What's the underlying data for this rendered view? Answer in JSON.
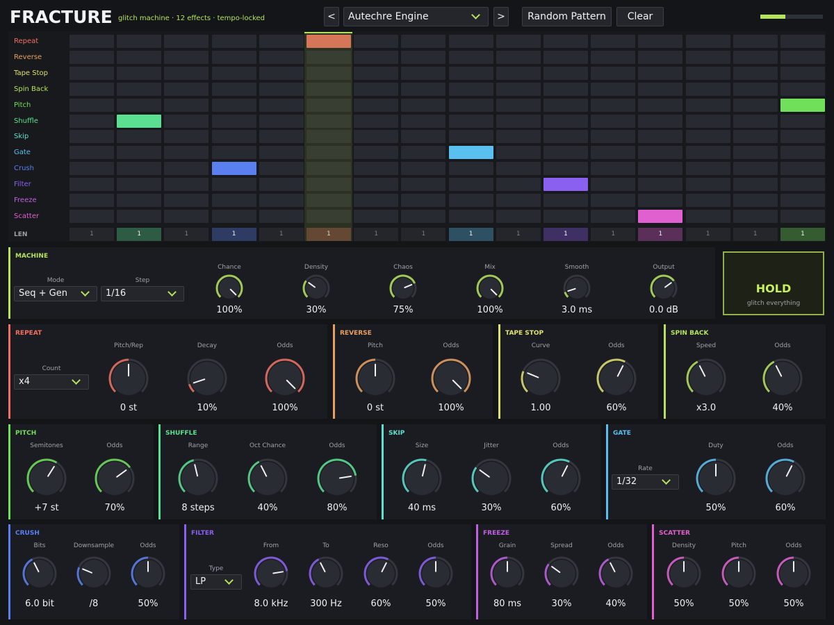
{
  "header": {
    "brand": "FRACTURE",
    "tagline": "glitch machine  ·  12 effects  ·  tempo-locked",
    "prev_label": "<",
    "next_label": ">",
    "preset": "Autechre Engine",
    "random_label": "Random Pattern",
    "clear_label": "Clear",
    "output_level": 0.4
  },
  "sequencer": {
    "steps": 16,
    "playhead_step": 6,
    "rows": [
      {
        "label": "Repeat",
        "color": "#f07060"
      },
      {
        "label": "Reverse",
        "color": "#e8a060"
      },
      {
        "label": "Tape Stop",
        "color": "#e0e070"
      },
      {
        "label": "Spin Back",
        "color": "#b5e35a"
      },
      {
        "label": "Pitch",
        "color": "#70e05a"
      },
      {
        "label": "Shuffle",
        "color": "#5ae090"
      },
      {
        "label": "Skip",
        "color": "#5ae0d0"
      },
      {
        "label": "Gate",
        "color": "#5ac0f0"
      },
      {
        "label": "Crush",
        "color": "#5a80f0"
      },
      {
        "label": "Filter",
        "color": "#8a60f0"
      },
      {
        "label": "Freeze",
        "color": "#c060e0"
      },
      {
        "label": "Scatter",
        "color": "#e060d0"
      }
    ],
    "active": [
      {
        "row": 0,
        "step": 5
      },
      {
        "row": 5,
        "step": 1
      },
      {
        "row": 8,
        "step": 3
      },
      {
        "row": 7,
        "step": 8
      },
      {
        "row": 9,
        "step": 10
      },
      {
        "row": 11,
        "step": 12
      },
      {
        "row": 4,
        "step": 15
      }
    ],
    "len_label": "LEN",
    "len_values": [
      "1",
      "1",
      "1",
      "1",
      "1",
      "1",
      "1",
      "1",
      "1",
      "1",
      "1",
      "1",
      "1",
      "1",
      "1",
      "1"
    ]
  },
  "machine": {
    "title": "MACHINE",
    "mode_label": "Mode",
    "mode_value": "Seq + Gen",
    "step_label": "Step",
    "step_value": "1/16",
    "knobs": [
      {
        "label": "Chance",
        "value": "100%",
        "level": 1.0
      },
      {
        "label": "Density",
        "value": "30%",
        "level": 0.3
      },
      {
        "label": "Chaos",
        "value": "75%",
        "level": 0.75
      },
      {
        "label": "Mix",
        "value": "100%",
        "level": 1.0
      },
      {
        "label": "Smooth",
        "value": "3.0 ms",
        "level": 0.1
      },
      {
        "label": "Output",
        "value": "0.0 dB",
        "level": 0.7
      }
    ]
  },
  "hold": {
    "title": "HOLD",
    "subtitle": "glitch everything"
  },
  "panels": {
    "repeat": {
      "title": "REPEAT",
      "color": "#f07060",
      "count_label": "Count",
      "count_value": "x4",
      "knobs": [
        {
          "label": "Pitch/Rep",
          "value": "0 st",
          "level": 0.5
        },
        {
          "label": "Decay",
          "value": "10%",
          "level": 0.1
        },
        {
          "label": "Odds",
          "value": "100%",
          "level": 1.0
        }
      ]
    },
    "reverse": {
      "title": "REVERSE",
      "color": "#e8a060",
      "knobs": [
        {
          "label": "Pitch",
          "value": "0 st",
          "level": 0.5
        },
        {
          "label": "Odds",
          "value": "100%",
          "level": 1.0
        }
      ]
    },
    "tapestop": {
      "title": "TAPE STOP",
      "color": "#e0e070",
      "knobs": [
        {
          "label": "Curve",
          "value": "1.00",
          "level": 0.25
        },
        {
          "label": "Odds",
          "value": "60%",
          "level": 0.6
        }
      ]
    },
    "spinback": {
      "title": "SPIN BACK",
      "color": "#b5e35a",
      "knobs": [
        {
          "label": "Speed",
          "value": "x3.0",
          "level": 0.4
        },
        {
          "label": "Odds",
          "value": "40%",
          "level": 0.4
        }
      ]
    },
    "pitch": {
      "title": "PITCH",
      "color": "#70e05a",
      "knobs": [
        {
          "label": "Semitones",
          "value": "+7 st",
          "level": 0.62
        },
        {
          "label": "Odds",
          "value": "70%",
          "level": 0.7
        }
      ]
    },
    "shuffle": {
      "title": "SHUFFLE",
      "color": "#5ae090",
      "knobs": [
        {
          "label": "Range",
          "value": "8 steps",
          "level": 0.45
        },
        {
          "label": "Oct Chance",
          "value": "40%",
          "level": 0.4
        },
        {
          "label": "Odds",
          "value": "80%",
          "level": 0.8
        }
      ]
    },
    "skip": {
      "title": "SKIP",
      "color": "#5ae0d0",
      "knobs": [
        {
          "label": "Size",
          "value": "40 ms",
          "level": 0.55
        },
        {
          "label": "Jitter",
          "value": "30%",
          "level": 0.3
        },
        {
          "label": "Odds",
          "value": "60%",
          "level": 0.6
        }
      ]
    },
    "gate": {
      "title": "GATE",
      "color": "#5ac0f0",
      "rate_label": "Rate",
      "rate_value": "1/32",
      "knobs": [
        {
          "label": "Duty",
          "value": "50%",
          "level": 0.5
        },
        {
          "label": "Odds",
          "value": "60%",
          "level": 0.6
        }
      ]
    },
    "crush": {
      "title": "CRUSH",
      "color": "#5a80f0",
      "knobs": [
        {
          "label": "Bits",
          "value": "6.0 bit",
          "level": 0.4
        },
        {
          "label": "Downsample",
          "value": "/8",
          "level": 0.25
        },
        {
          "label": "Odds",
          "value": "50%",
          "level": 0.5
        }
      ]
    },
    "filter": {
      "title": "FILTER",
      "color": "#8a60f0",
      "type_label": "Type",
      "type_value": "LP",
      "knobs": [
        {
          "label": "From",
          "value": "8.0 kHz",
          "level": 0.8
        },
        {
          "label": "To",
          "value": "300 Hz",
          "level": 0.4
        },
        {
          "label": "Reso",
          "value": "60%",
          "level": 0.6
        },
        {
          "label": "Odds",
          "value": "50%",
          "level": 0.5
        }
      ]
    },
    "freeze": {
      "title": "FREEZE",
      "color": "#c060e0",
      "knobs": [
        {
          "label": "Grain",
          "value": "80 ms",
          "level": 0.5
        },
        {
          "label": "Spread",
          "value": "30%",
          "level": 0.3
        },
        {
          "label": "Odds",
          "value": "40%",
          "level": 0.4
        }
      ]
    },
    "scatter": {
      "title": "SCATTER",
      "color": "#e060d0",
      "knobs": [
        {
          "label": "Density",
          "value": "50%",
          "level": 0.5
        },
        {
          "label": "Pitch",
          "value": "50%",
          "level": 0.5
        },
        {
          "label": "Odds",
          "value": "50%",
          "level": 0.5
        }
      ]
    }
  }
}
